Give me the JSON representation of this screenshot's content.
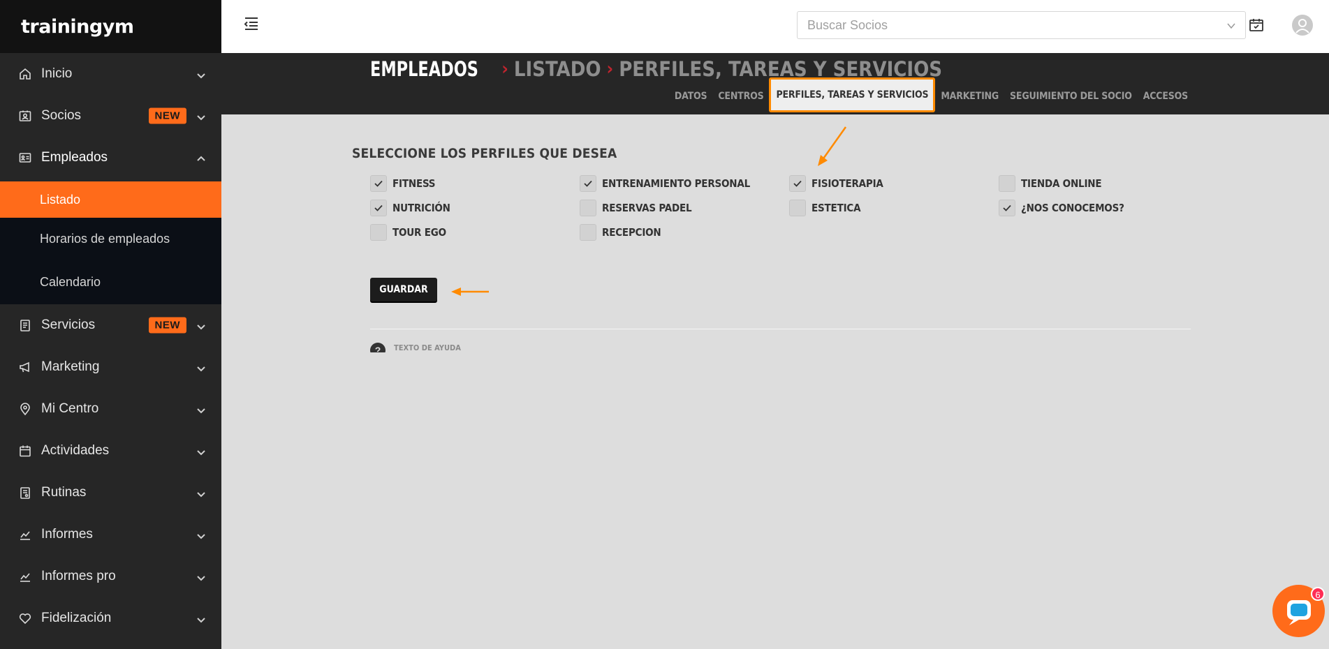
{
  "app": {
    "logo_text": "trainingym"
  },
  "sidebar": {
    "items": [
      {
        "label": "Inicio",
        "icon": "home-icon",
        "badge": ""
      },
      {
        "label": "Socios",
        "icon": "members-icon",
        "badge": "NEW"
      },
      {
        "label": "Empleados",
        "icon": "id-card-icon",
        "badge": "",
        "expanded": true
      },
      {
        "label": "Servicios",
        "icon": "clipboard-icon",
        "badge": "NEW"
      },
      {
        "label": "Marketing",
        "icon": "megaphone-icon",
        "badge": ""
      },
      {
        "label": "Mi Centro",
        "icon": "location-pin-icon",
        "badge": ""
      },
      {
        "label": "Actividades",
        "icon": "calendar-icon",
        "badge": ""
      },
      {
        "label": "Rutinas",
        "icon": "routine-icon",
        "badge": ""
      },
      {
        "label": "Informes",
        "icon": "chart-line-icon",
        "badge": ""
      },
      {
        "label": "Informes pro",
        "icon": "chart-line-icon",
        "badge": ""
      },
      {
        "label": "Fidelización",
        "icon": "heart-icon",
        "badge": ""
      }
    ],
    "empleados_submenu": [
      {
        "label": "Listado",
        "active": true
      },
      {
        "label": "Horarios de empleados",
        "active": false
      },
      {
        "label": "Calendario",
        "active": false
      }
    ]
  },
  "topbar": {
    "search_placeholder": "Buscar Socios"
  },
  "breadcrumb": {
    "level1": "EMPLEADOS",
    "level2": "LISTADO",
    "level3": "PERFILES, TAREAS Y SERVICIOS",
    "separator": "›"
  },
  "tabs": [
    {
      "label": "DATOS",
      "active": false
    },
    {
      "label": "CENTROS",
      "active": false
    },
    {
      "label": "PERFILES, TAREAS Y SERVICIOS",
      "active": true
    },
    {
      "label": "MARKETING",
      "active": false
    },
    {
      "label": "SEGUIMIENTO DEL SOCIO",
      "active": false
    },
    {
      "label": "ACCESOS",
      "active": false
    }
  ],
  "profiles": {
    "title": "SELECCIONE LOS PERFILES QUE DESEA",
    "options": [
      {
        "label": "FITNESS",
        "checked": true
      },
      {
        "label": "ENTRENAMIENTO PERSONAL",
        "checked": true
      },
      {
        "label": "FISIOTERAPIA",
        "checked": true
      },
      {
        "label": "TIENDA ONLINE",
        "checked": false
      },
      {
        "label": "NUTRICIÓN",
        "checked": true
      },
      {
        "label": "RESERVAS PADEL",
        "checked": false
      },
      {
        "label": "ESTETICA",
        "checked": false
      },
      {
        "label": "¿NOS CONOCEMOS?",
        "checked": true
      },
      {
        "label": "TOUR EGO",
        "checked": false
      },
      {
        "label": "RECEPCION",
        "checked": false
      }
    ],
    "save_label": "GUARDAR",
    "help_text": "TEXTO DE AYUDA",
    "help_icon_glyph": "?"
  },
  "chat": {
    "unread_count": "6"
  },
  "colors": {
    "accent": "#ff6b1a",
    "annotation": "#ff8a00",
    "sidebar_bg": "#262626",
    "breadcrumb_separator": "#c0242e"
  }
}
